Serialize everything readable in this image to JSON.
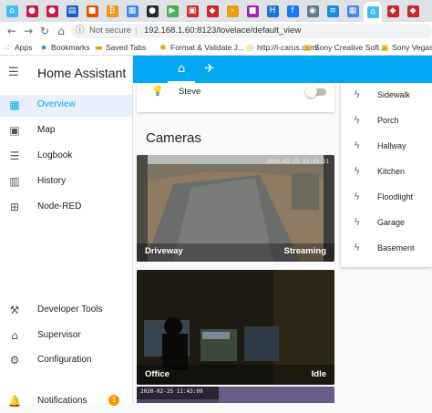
{
  "browser": {
    "tabs": [
      {
        "icon": "home-assistant-icon",
        "glyph": "⌂",
        "color": "#41bdf5"
      },
      {
        "icon": "raspberry-icon",
        "glyph": "●",
        "color": "#c51a4a"
      },
      {
        "icon": "raspberry-icon",
        "glyph": "●",
        "color": "#c51a4a"
      },
      {
        "icon": "news-icon",
        "glyph": "▤",
        "color": "#1565c0"
      },
      {
        "icon": "bookmark-icon",
        "glyph": "■",
        "color": "#e65100"
      },
      {
        "icon": "bitcoin-icon",
        "glyph": "₿",
        "color": "#f7931a"
      },
      {
        "icon": "doc-icon",
        "glyph": "▦",
        "color": "#4285f4"
      },
      {
        "icon": "github-icon",
        "glyph": "●",
        "color": "#24292e"
      },
      {
        "icon": "media-icon",
        "glyph": "▶",
        "color": "#4caf50"
      },
      {
        "icon": "video-icon",
        "glyph": "▣",
        "color": "#d32f2f"
      },
      {
        "icon": "tab-icon",
        "glyph": "◆",
        "color": "#c62828"
      },
      {
        "icon": "plex-icon",
        "glyph": "›",
        "color": "#e5a00d"
      },
      {
        "icon": "tab-icon",
        "glyph": "■",
        "color": "#9c27b0"
      },
      {
        "icon": "h-icon",
        "glyph": "H",
        "color": "#1976d2"
      },
      {
        "icon": "facebook-icon",
        "glyph": "f",
        "color": "#1877f2"
      },
      {
        "icon": "shield-icon",
        "glyph": "◉",
        "color": "#607d8b"
      },
      {
        "icon": "list-icon",
        "glyph": "≡",
        "color": "#1e88e5"
      },
      {
        "icon": "doc-icon",
        "glyph": "▦",
        "color": "#4285f4"
      },
      {
        "icon": "home-assistant-icon",
        "glyph": "⌂",
        "color": "#41bdf5"
      },
      {
        "icon": "tab-icon",
        "glyph": "◆",
        "color": "#c62828"
      },
      {
        "icon": "tab-icon",
        "glyph": "◆",
        "color": "#c62828"
      }
    ],
    "security_label": "Not secure",
    "url": "192.168.1.60:8123/lovelace/default_view",
    "bookmarks": [
      {
        "icon": "apps-icon",
        "glyph": "⁙",
        "label": "Apps"
      },
      {
        "icon": "star-icon",
        "glyph": "★",
        "label": "Bookmarks"
      },
      {
        "icon": "folder-icon",
        "glyph": "▬",
        "label": "Saved Tabs"
      },
      {
        "icon": "gear-icon",
        "glyph": "✱",
        "label": "Format & Validate J..."
      },
      {
        "icon": "page-icon",
        "glyph": "◎",
        "label": "http://i-carus.com/"
      },
      {
        "icon": "sony-icon",
        "glyph": "▣",
        "label": "Sony Creative Soft..."
      },
      {
        "icon": "sony-icon",
        "glyph": "▣",
        "label": "Sony Vegas P"
      }
    ]
  },
  "app": {
    "title": "Home Assistant",
    "nav_top": [
      {
        "name": "overview",
        "icon": "grid-icon",
        "glyph": "▦",
        "label": "Overview",
        "selected": true
      },
      {
        "name": "map",
        "icon": "map-icon",
        "glyph": "▣",
        "label": "Map"
      },
      {
        "name": "logbook",
        "icon": "list-icon",
        "glyph": "☰",
        "label": "Logbook"
      },
      {
        "name": "history",
        "icon": "chart-icon",
        "glyph": "▥",
        "label": "History"
      },
      {
        "name": "node-red",
        "icon": "sitemap-icon",
        "glyph": "⊞",
        "label": "Node-RED"
      }
    ],
    "nav_bottom": [
      {
        "name": "developer-tools",
        "icon": "hammer-icon",
        "glyph": "⚒",
        "label": "Developer Tools"
      },
      {
        "name": "supervisor",
        "icon": "home-assistant-icon",
        "glyph": "⌂",
        "label": "Supervisor"
      },
      {
        "name": "configuration",
        "icon": "gear-icon",
        "glyph": "⚙",
        "label": "Configuration"
      },
      {
        "name": "notifications",
        "icon": "bell-icon",
        "glyph": "🔔",
        "label": "Notifications",
        "badge": "1"
      }
    ],
    "view_tabs": [
      {
        "icon": "home-icon",
        "glyph": "⌂",
        "selected": true
      },
      {
        "icon": "satellite-icon",
        "glyph": "✈",
        "selected": false
      }
    ],
    "entity_row": {
      "icon": "bulb-icon",
      "glyph": "💡",
      "name": "Steve",
      "state": "off"
    },
    "cameras_heading": "Cameras",
    "cameras": [
      {
        "name": "Driveway",
        "state": "Streaming",
        "timestamp": "2020-02-25 11:43:21"
      },
      {
        "name": "Office",
        "state": "Idle",
        "timestamp": ""
      },
      {
        "name": "",
        "state": "",
        "timestamp": "2020-02-25  11:43:09"
      }
    ],
    "switches": [
      {
        "icon": "flash-icon",
        "glyph": "ϟ",
        "label": "Sidewalk"
      },
      {
        "icon": "flash-icon",
        "glyph": "ϟ",
        "label": "Porch"
      },
      {
        "icon": "flash-icon",
        "glyph": "ϟ",
        "label": "Hallway"
      },
      {
        "icon": "flash-icon",
        "glyph": "ϟ",
        "label": "Kitchen"
      },
      {
        "icon": "flash-icon",
        "glyph": "ϟ",
        "label": "Floodlight"
      },
      {
        "icon": "flash-icon",
        "glyph": "ϟ",
        "label": "Garage"
      },
      {
        "icon": "flash-icon",
        "glyph": "ϟ",
        "label": "Basement"
      }
    ],
    "accent_color": "#03a9f4"
  }
}
